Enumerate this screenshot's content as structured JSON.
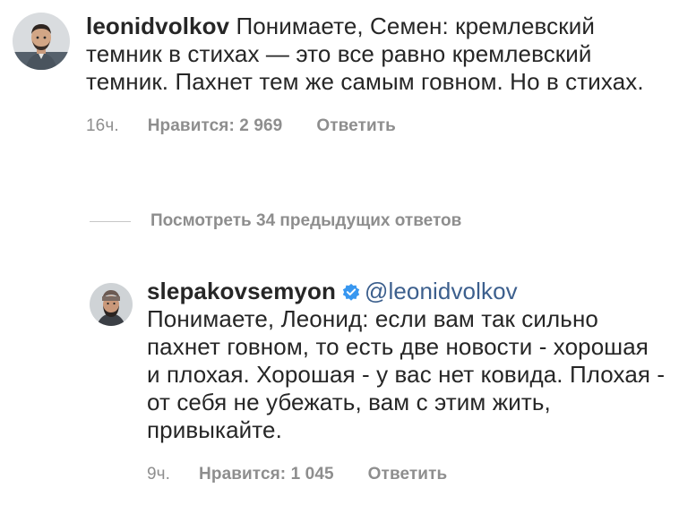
{
  "comments": [
    {
      "username": "leonidvolkov",
      "text": " Понимаете, Семен: кремлевский темник в стихах — это все равно кремлевский темник. Пахнет тем же самым говном. Но в стихах.",
      "time": "16ч.",
      "likes": "Нравится: 2 969",
      "reply_label": "Ответить"
    }
  ],
  "view_replies": {
    "label": "Посмотреть 34 предыдущих ответов"
  },
  "reply": {
    "username": "slepakovsemyon",
    "mention": "@leonidvolkov",
    "text": "Понимаете, Леонид: если вам так сильно пахнет говном, то есть две новости - хорошая и плохая. Хорошая - у вас нет ковида. Плохая - от себя не убежать, вам с этим жить, привыкайте.",
    "time": "9ч.",
    "likes": "Нравится: 1 045",
    "reply_label": "Ответить"
  },
  "colors": {
    "text": "#262626",
    "meta": "#8e8e8e",
    "mention": "#3c5f8d",
    "verified": "#3897f0"
  }
}
